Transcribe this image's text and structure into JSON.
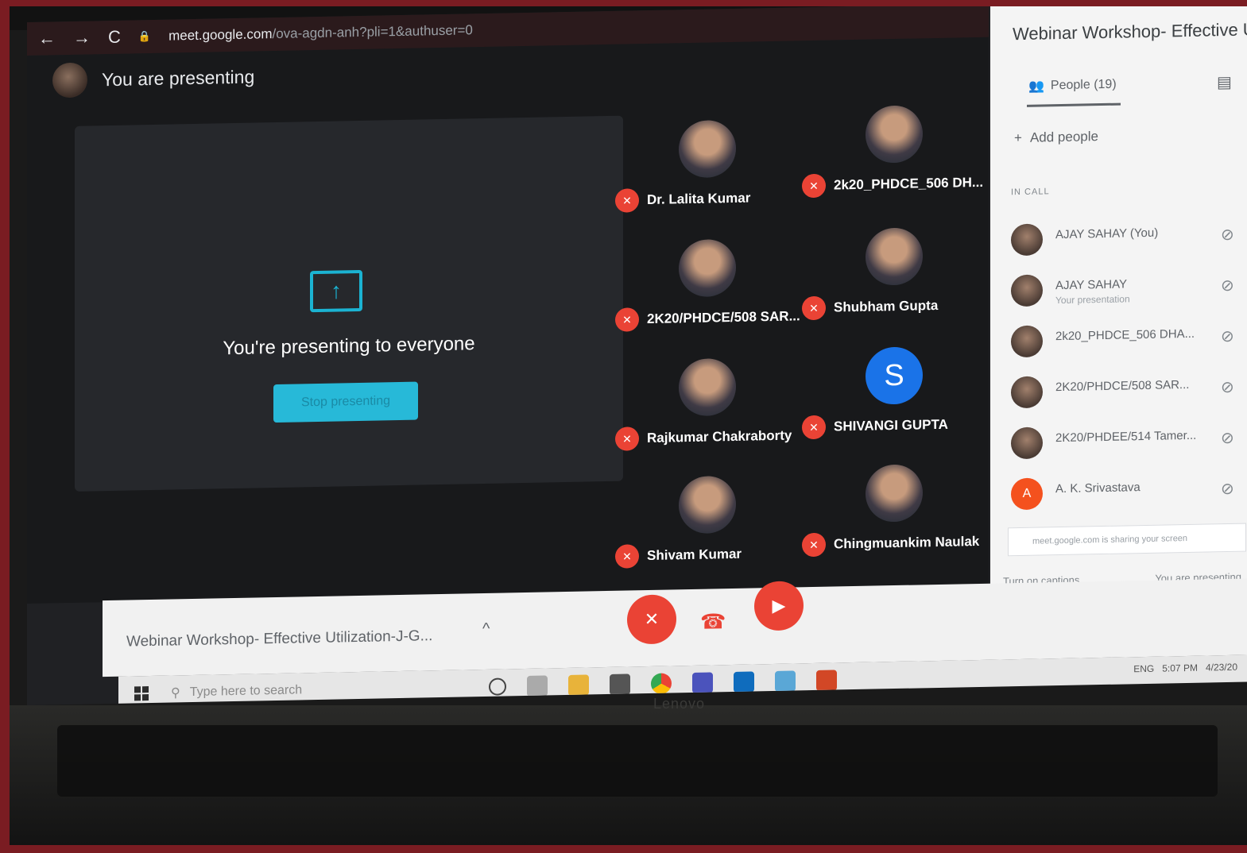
{
  "browser": {
    "url_host": "meet.google.com",
    "url_path": "/ova-agdn-anh?pli=1&authuser=0",
    "back_icon": "←",
    "forward_icon": "→",
    "reload_icon": "C",
    "lock_icon": "🔒"
  },
  "stage": {
    "presenting_title": "You are presenting",
    "present_message": "You're presenting to everyone",
    "stop_label": "Stop presenting",
    "share_icon": "↑"
  },
  "tiles": [
    {
      "name": "Dr. Lalita Kumar"
    },
    {
      "name": "2k20_PHDCE_506 DH..."
    },
    {
      "name": "2K20/PHDCE/508 SAR..."
    },
    {
      "name": "Shubham Gupta"
    },
    {
      "name": "Rajkumar Chakraborty"
    },
    {
      "name": "SHIVANGI GUPTA",
      "letter": "S"
    },
    {
      "name": "Shivam Kumar"
    },
    {
      "name": "Chingmuankim Naulak"
    }
  ],
  "panel": {
    "title": "Webinar Workshop- Effective U",
    "people_tab": "People (19)",
    "people_icon": "👥",
    "add_people": "Add people",
    "add_icon": "+",
    "in_call": "IN CALL",
    "participants": [
      {
        "name": "AJAY SAHAY (You)",
        "sub": ""
      },
      {
        "name": "AJAY SAHAY",
        "sub": "Your presentation"
      },
      {
        "name": "2k20_PHDCE_506 DHA...",
        "sub": ""
      },
      {
        "name": "2K20/PHDCE/508 SAR...",
        "sub": ""
      },
      {
        "name": "2K20/PHDEE/514 Tamer...",
        "sub": ""
      },
      {
        "name": "A. K. Srivastava",
        "sub": "",
        "letter": "A"
      }
    ],
    "share_notice": "meet.google.com is sharing your screen",
    "captions": "Turn on captions",
    "you_presenting": "You are presenting"
  },
  "bottom": {
    "meeting_name": "Webinar Workshop- Effective Utilization-J-G...",
    "chevron": "^",
    "hangup_icon": "☎",
    "mic_icon": "🎤",
    "cam_icon": "▶"
  },
  "taskbar": {
    "search_placeholder": "Type here to search",
    "search_icon": "⚲",
    "lang": "ENG",
    "time": "5:07 PM",
    "date": "4/23/20"
  },
  "colors": {
    "accent": "#27b9d8",
    "danger": "#ea4335",
    "frame": "#7a1c22"
  },
  "device": {
    "brand": "Lenovo"
  }
}
